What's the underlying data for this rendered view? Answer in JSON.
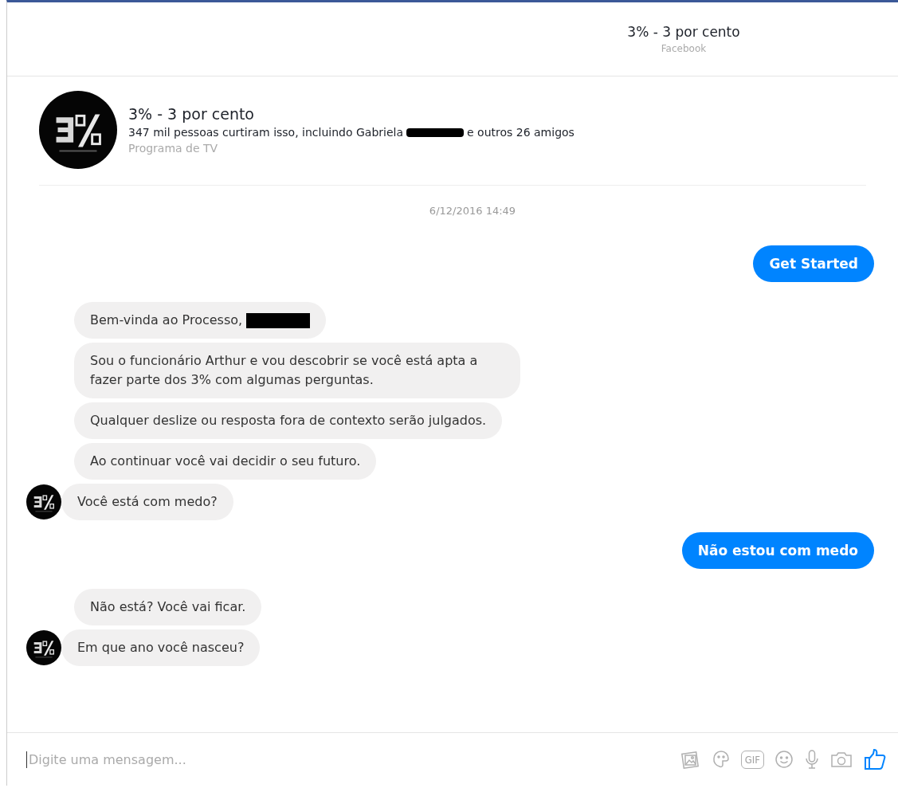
{
  "header": {
    "title": "3% - 3 por cento",
    "subtitle": "Facebook"
  },
  "page_info": {
    "name": "3% - 3 por cento",
    "likes_before": "347 mil pessoas curtiram isso, incluindo Gabriela",
    "likes_redacted": true,
    "likes_after": "e outros 26 amigos",
    "category": "Programa de TV"
  },
  "timestamp": "6/12/2016 14:49",
  "messages": [
    {
      "kind": "outgoing",
      "text": "Get Started",
      "redacted": false
    },
    {
      "kind": "incoming",
      "text": "Bem-vinda ao Processo,",
      "avatar": false,
      "redacted": true
    },
    {
      "kind": "incoming",
      "text": "Sou o funcionário Arthur e vou descobrir se você está apta a fazer parte dos 3% com algumas perguntas.",
      "avatar": false,
      "redacted": false
    },
    {
      "kind": "incoming",
      "text": "Qualquer deslize ou resposta fora de contexto serão julgados.",
      "avatar": false,
      "redacted": false
    },
    {
      "kind": "incoming",
      "text": "Ao continuar você vai decidir o seu futuro.",
      "avatar": false,
      "redacted": false
    },
    {
      "kind": "incoming",
      "text": "Você está com medo?",
      "avatar": true,
      "redacted": false
    },
    {
      "kind": "outgoing",
      "text": "Não estou com medo",
      "redacted": false
    },
    {
      "kind": "incoming",
      "text": "Não está? Você vai ficar.",
      "avatar": false,
      "redacted": false
    },
    {
      "kind": "incoming",
      "text": "Em que ano você nasceu?",
      "avatar": true,
      "redacted": false
    }
  ],
  "composer": {
    "placeholder": "Digite uma mensagem...",
    "gif_label": "GIF"
  }
}
